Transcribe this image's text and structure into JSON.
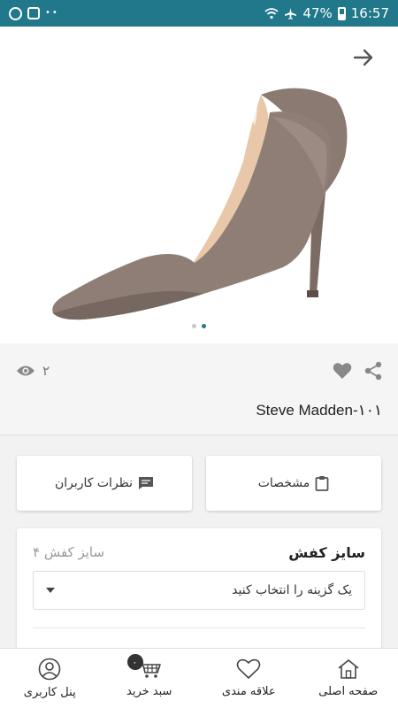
{
  "status_bar": {
    "battery": "47%",
    "time": "16:57"
  },
  "product": {
    "title": "Steve Madden-۱۰۱",
    "views": "۲"
  },
  "buttons": {
    "specs": "مشخصات",
    "reviews": "نظرات کاربران"
  },
  "size": {
    "title": "سایز کفش",
    "count": "۴ سایز کفش",
    "placeholder": "یک گزینه را انتخاب کنید"
  },
  "bottom_nav": {
    "home": "صفحه اصلی",
    "favorites": "علاقه مندی",
    "cart": "سبد خرید",
    "cart_count": "۰",
    "profile": "پنل کاربری"
  },
  "colors": {
    "accent": "#20788a"
  }
}
